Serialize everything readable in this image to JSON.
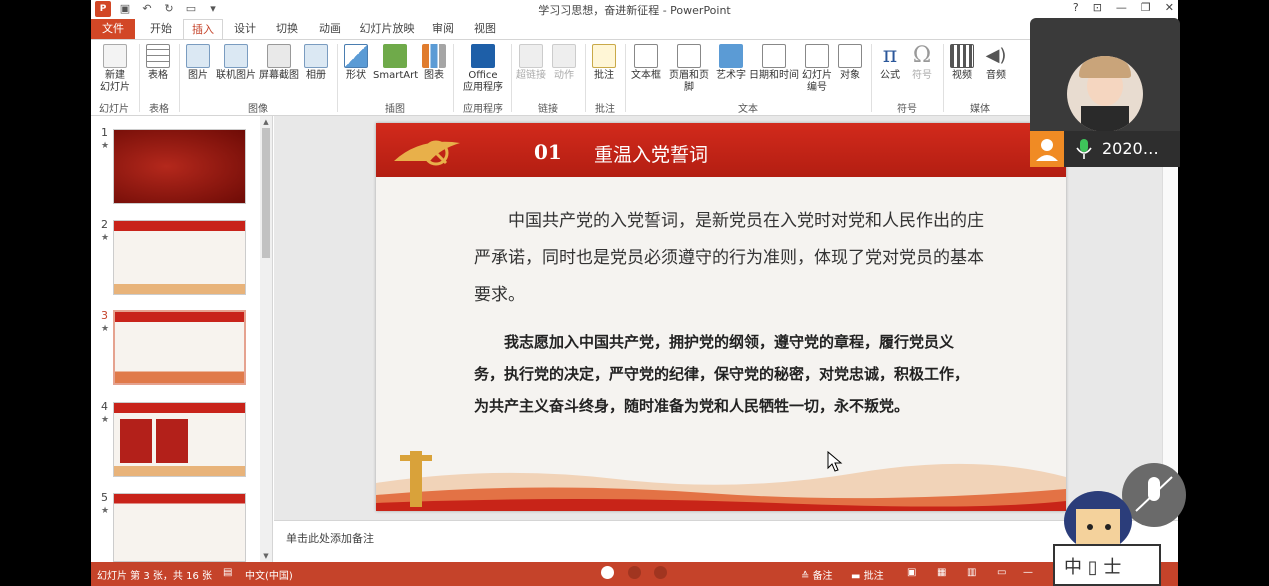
{
  "window": {
    "title": "学习习思想，奋进新征程 - PowerPoint",
    "controls": [
      "?",
      "⊡",
      "—",
      "❐",
      "✕"
    ]
  },
  "tabs": [
    "文件",
    "开始",
    "插入",
    "设计",
    "切换",
    "动画",
    "幻灯片放映",
    "审阅",
    "视图"
  ],
  "ribbon": {
    "buttons": {
      "new_slide": "新建\n幻灯片",
      "table": "表格",
      "picture": "图片",
      "online_picture": "联机图片",
      "screenshot": "屏幕截图",
      "album": "相册",
      "shapes": "形状",
      "smartart": "SmartArt",
      "chart": "图表",
      "office_apps": "Office\n应用程序",
      "hyperlink": "超链接",
      "action": "动作",
      "comment": "批注",
      "textbox": "文本框",
      "header_footer": "页眉和页脚",
      "wordart": "艺术字",
      "datetime": "日期和时间",
      "slide_number": "幻灯片\n编号",
      "object": "对象",
      "equation": "公式",
      "symbol": "符号",
      "video": "视频",
      "audio": "音频"
    },
    "groups": {
      "slides": "幻灯片",
      "tables": "表格",
      "images": "图像",
      "illustrations": "插图",
      "apps": "应用程序",
      "links": "链接",
      "comments": "批注",
      "text": "文本",
      "symbols": "符号",
      "media": "媒体"
    }
  },
  "thumbnails": [
    {
      "num": "1",
      "star": "★"
    },
    {
      "num": "2",
      "star": "★"
    },
    {
      "num": "3",
      "star": "★"
    },
    {
      "num": "4",
      "star": "★"
    },
    {
      "num": "5",
      "star": "★"
    }
  ],
  "slide": {
    "header_num": "01",
    "header_title": "重温入党誓词",
    "paragraph1": "中国共产党的入党誓词，是新党员在入党时对党和人民作出的庄严承诺，同时也是党员必须遵守的行为准则，体现了党对党员的基本要求。",
    "paragraph2": "我志愿加入中国共产党，拥护党的纲领，遵守党的章程，履行党员义务，执行党的决定，严守党的纪律，保守党的秘密，对党忠诚，积极工作，为共产主义奋斗终身，随时准备为党和人民牺牲一切，永不叛党。"
  },
  "notes": {
    "placeholder": "单击此处添加备注"
  },
  "status": {
    "slide_info": "幻灯片 第 3 张，共 16 张",
    "language": "中文(中国)",
    "notes_btn": "备注",
    "comments_btn": "批注"
  },
  "webcam": {
    "name": "2020…"
  },
  "colors": {
    "accent": "#c5432a",
    "slide_red": "#c8231a"
  }
}
